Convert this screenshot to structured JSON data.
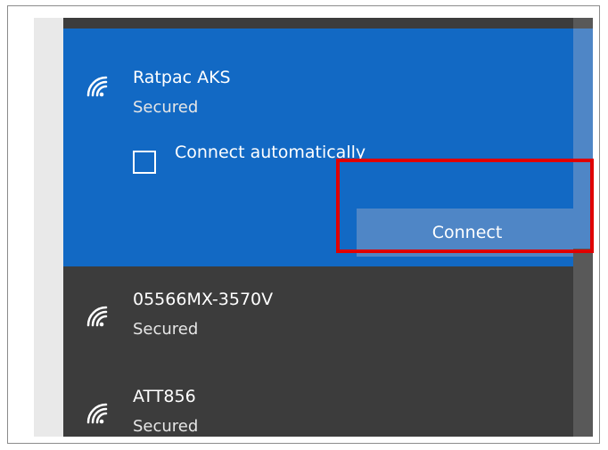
{
  "networks": [
    {
      "ssid": "Ratpac AKS",
      "status": "Secured",
      "selected": true,
      "connect_automatically_label": "Connect automatically",
      "connect_button_label": "Connect"
    },
    {
      "ssid": "05566MX-3570V",
      "status": "Secured"
    },
    {
      "ssid": "ATT856",
      "status": "Secured"
    }
  ],
  "colors": {
    "selected_bg": "#1269c4",
    "list_bg": "#3c3c3c",
    "button_bg": "#4f86c6",
    "highlight_border": "#e00000"
  },
  "icons": [
    "wifi-secured-icon"
  ]
}
